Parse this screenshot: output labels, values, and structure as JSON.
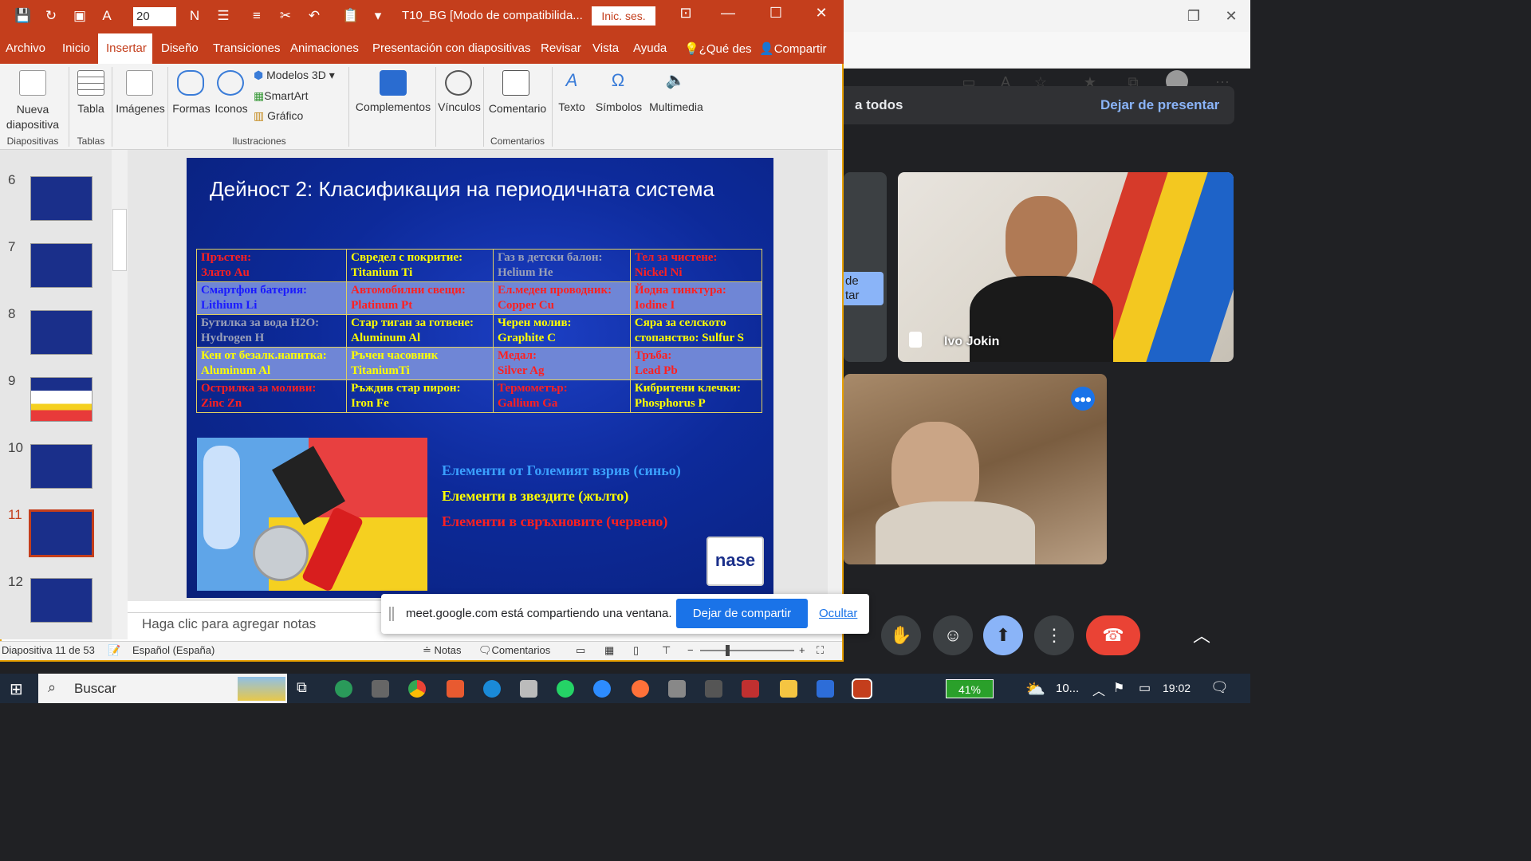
{
  "powerpoint": {
    "font_size": "20",
    "doc_title": "T10_BG [Modo de compatibilida...",
    "signin": "Inic. ses.",
    "tabs": [
      "Archivo",
      "Inicio",
      "Insertar",
      "Diseño",
      "Transiciones",
      "Animaciones",
      "Presentación con diapositivas",
      "Revisar",
      "Vista",
      "Ayuda",
      "¿Qué des",
      "Compartir"
    ],
    "ribbon": {
      "new_slide": [
        "Nueva",
        "diapositiva"
      ],
      "table": "Tabla",
      "images": "Imágenes",
      "shapes": "Formas",
      "icons": "Iconos",
      "models3d": "Modelos 3D",
      "smartart": "SmartArt",
      "chart": "Gráfico",
      "addins": "Complementos",
      "links": "Vínculos",
      "comment": "Comentario",
      "text": "Texto",
      "symbols": "Símbolos",
      "multimedia": "Multimedia",
      "groups": [
        "Diapositivas",
        "Tablas",
        "Ilustraciones",
        "Comentarios"
      ]
    },
    "thumbnails": [
      "6",
      "7",
      "8",
      "9",
      "10",
      "11",
      "12"
    ],
    "slide": {
      "title": "Дейност 2: Класификация на периодичната система",
      "table": [
        [
          [
            "Пръстен:",
            "Злато Au",
            "red"
          ],
          [
            "Свредел с покритие:",
            "Titanium Ti",
            "yellow"
          ],
          [
            "Газ в детски балон:",
            "Helium He",
            "gray"
          ],
          [
            "Тел за чистене:",
            "Nickel Ni",
            "red"
          ]
        ],
        [
          [
            "Смартфон батерия:",
            "Lithium Li",
            "blue"
          ],
          [
            "Автомобилни свещи:",
            "Platinum Pt",
            "red"
          ],
          [
            "Ел.меден проводник:",
            "Copper Cu",
            "red"
          ],
          [
            "Йодна тинктура:",
            "Iodine I",
            "red"
          ]
        ],
        [
          [
            "Бутилка за вода H2O:",
            "Hydrogen H",
            "gray"
          ],
          [
            "Стар тиган за готвене:",
            "Aluminum Al",
            "yellow"
          ],
          [
            "Черен молив:",
            "Graphite C",
            "yellow"
          ],
          [
            "Сяра за селското",
            "стопанство: Sulfur  S",
            "yellow"
          ]
        ],
        [
          [
            "Кен от безалк.напитка:",
            "Aluminum Al",
            "yellow"
          ],
          [
            "Ръчен часовник",
            "TitaniumTi",
            "yellow"
          ],
          [
            "Медал:",
            "Silver Ag",
            "red"
          ],
          [
            "Тръба:",
            "Lead Pb",
            "red"
          ]
        ],
        [
          [
            "Острилка за моливи:",
            "Zinc Zn",
            "red"
          ],
          [
            "Ръждив стар пирон:",
            "Iron Fe",
            "yellow"
          ],
          [
            "Термометър:",
            "Gallium Ga",
            "red"
          ],
          [
            "Кибритени клечки:",
            "Phosphorus P",
            "yellow"
          ]
        ]
      ],
      "legend": [
        "Елементи от Големият взрив (синьо)",
        "Елементи в звездите (жълто)",
        "Елементи в свръхновите (червено)"
      ],
      "logo_text": "nase"
    },
    "notes_placeholder": "Haga clic para agregar notas",
    "status": {
      "slide_info": "Diapositiva 11 de 53",
      "language": "Español (España)",
      "notes": "Notas",
      "comments": "Comentarios"
    }
  },
  "meet": {
    "presenting_to": "a todos",
    "stop_presenting": "Dejar de presentar",
    "participant_name": "Ivo Jokin",
    "small_tile_text": [
      "de",
      "tar"
    ]
  },
  "share_banner": {
    "text": "meet.google.com está compartiendo una ventana.",
    "stop": "Dejar de compartir",
    "hide": "Ocultar"
  },
  "taskbar": {
    "search": "Buscar",
    "battery": "41%",
    "tray_text": "10...",
    "time": "19:02"
  },
  "colors": {
    "ppt_accent": "#c43e1c",
    "meet_bg": "#202124",
    "meet_blue": "#8ab4f8",
    "end_call": "#ea4335"
  }
}
